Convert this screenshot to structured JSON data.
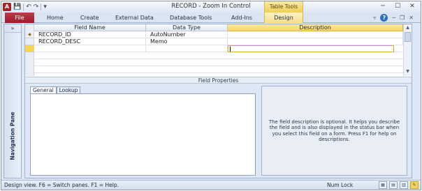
{
  "window": {
    "title": "RECORD  -  Zoom In Control",
    "app_icon_letter": "A",
    "contextual_group": "Table Tools",
    "buttons": {
      "minimize": "─",
      "maximize": "☐",
      "close": "✕"
    }
  },
  "quick_access": {
    "save_icon": "💾",
    "undo_icon": "↶",
    "redo_icon": "↷",
    "customize_icon": "▾"
  },
  "ribbon": {
    "file_tab": "File",
    "tabs": [
      "Home",
      "Create",
      "External Data",
      "Database Tools",
      "Add-Ins",
      "Design"
    ],
    "right_icons": {
      "collapse": "▿",
      "help": "?",
      "min": "─",
      "restore": "❐",
      "close": "✕"
    }
  },
  "nav_pane": {
    "toggle": "»",
    "label": "Navigation Pane"
  },
  "grid": {
    "headers": {
      "field_name": "Field Name",
      "data_type": "Data Type",
      "description": "Description"
    },
    "rows": [
      {
        "field_name": "RECORD_ID",
        "data_type": "AutoNumber",
        "description": ""
      },
      {
        "field_name": "RECORD_DESC",
        "data_type": "Memo",
        "description": ""
      }
    ]
  },
  "field_properties": {
    "title": "Field Properties",
    "tabs": [
      "General",
      "Lookup"
    ],
    "hint": "The field description is optional.  It helps you describe the field and is also displayed in the status bar when you select this field on a form.  Press F1 for help on descriptions."
  },
  "status": {
    "text": "Design view.  F6 = Switch panes.  F1 = Help.",
    "num_lock": "Num Lock"
  },
  "colors": {
    "file_tab": "#a01a2c",
    "table_tools": "#f1cf56",
    "active_view": "#f5d35b"
  }
}
